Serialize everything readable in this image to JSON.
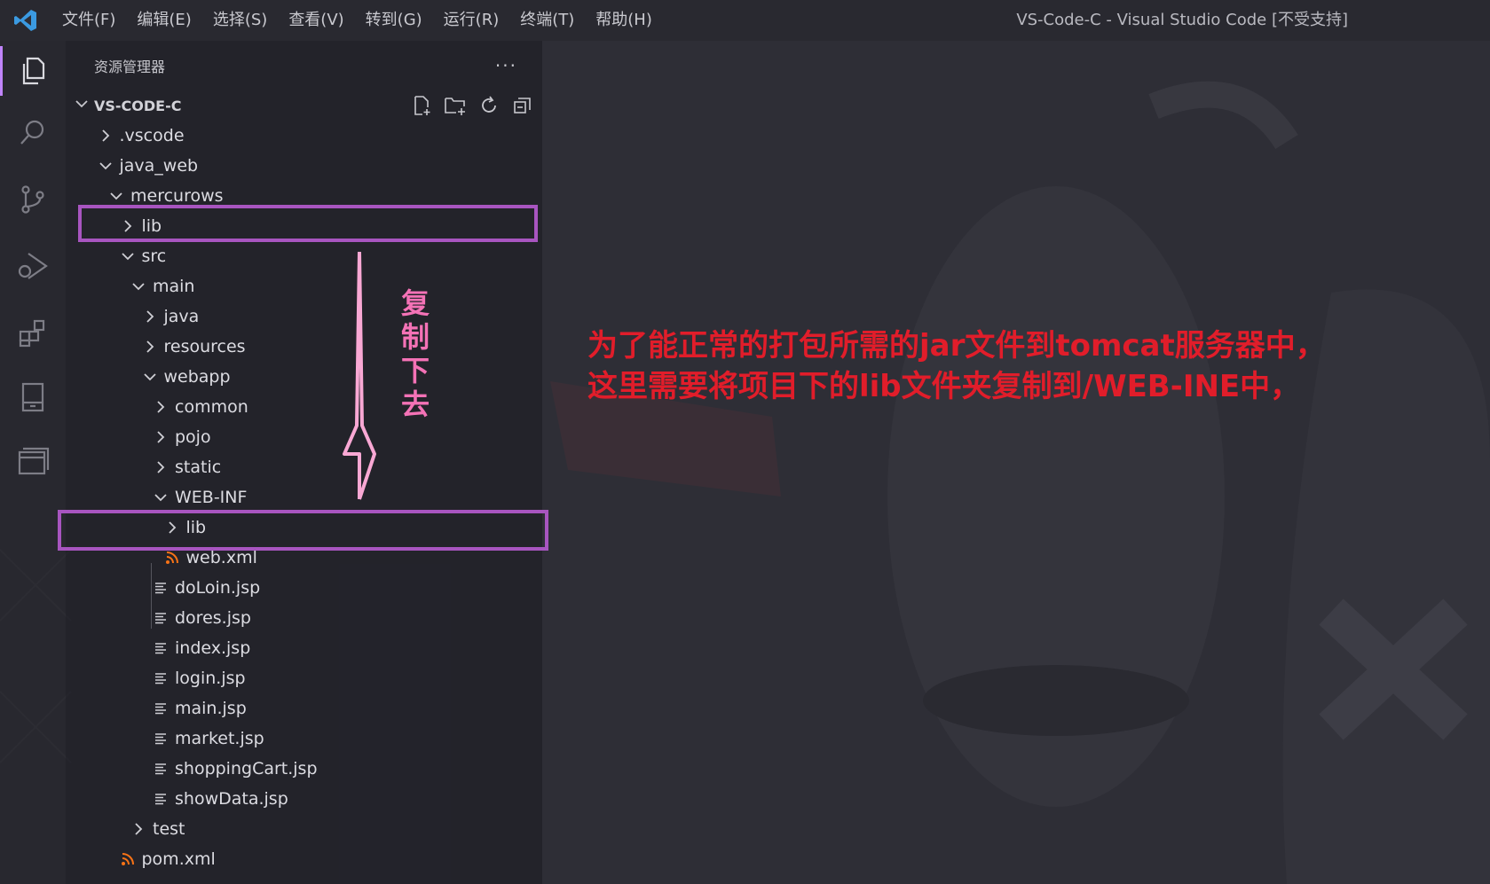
{
  "titlebar": {
    "menu": [
      "文件(F)",
      "编辑(E)",
      "选择(S)",
      "查看(V)",
      "转到(G)",
      "运行(R)",
      "终端(T)",
      "帮助(H)"
    ],
    "window_title": "VS-Code-C - Visual Studio Code [不受支持]"
  },
  "activitybar": {
    "items": [
      "explorer-icon",
      "search-icon",
      "source-control-icon",
      "run-debug-icon",
      "extensions-icon",
      "remote-explorer-icon",
      "panel-icon"
    ]
  },
  "sidebar": {
    "title": "资源管理器",
    "more": "···",
    "section": "VS-CODE-C",
    "tree": [
      {
        "label": ".vscode",
        "type": "folder",
        "expanded": false,
        "depth": 1
      },
      {
        "label": "java_web",
        "type": "folder",
        "expanded": true,
        "depth": 1
      },
      {
        "label": "mercurows",
        "type": "folder",
        "expanded": true,
        "depth": 2
      },
      {
        "label": "lib",
        "type": "folder",
        "expanded": false,
        "depth": 3
      },
      {
        "label": "src",
        "type": "folder",
        "expanded": true,
        "depth": 3
      },
      {
        "label": "main",
        "type": "folder",
        "expanded": true,
        "depth": 4
      },
      {
        "label": "java",
        "type": "folder",
        "expanded": false,
        "depth": 5
      },
      {
        "label": "resources",
        "type": "folder",
        "expanded": false,
        "depth": 5
      },
      {
        "label": "webapp",
        "type": "folder",
        "expanded": true,
        "depth": 5
      },
      {
        "label": "common",
        "type": "folder",
        "expanded": false,
        "depth": 6
      },
      {
        "label": "pojo",
        "type": "folder",
        "expanded": false,
        "depth": 6
      },
      {
        "label": "static",
        "type": "folder",
        "expanded": false,
        "depth": 6
      },
      {
        "label": "WEB-INF",
        "type": "folder",
        "expanded": true,
        "depth": 6
      },
      {
        "label": "lib",
        "type": "folder",
        "expanded": false,
        "depth": 7
      },
      {
        "label": "web.xml",
        "type": "xml",
        "depth": 7
      },
      {
        "label": "doLoin.jsp",
        "type": "file",
        "depth": 6
      },
      {
        "label": "dores.jsp",
        "type": "file",
        "depth": 6
      },
      {
        "label": "index.jsp",
        "type": "file",
        "depth": 6
      },
      {
        "label": "login.jsp",
        "type": "file",
        "depth": 6
      },
      {
        "label": "main.jsp",
        "type": "file",
        "depth": 6
      },
      {
        "label": "market.jsp",
        "type": "file",
        "depth": 6
      },
      {
        "label": "shoppingCart.jsp",
        "type": "file",
        "depth": 6
      },
      {
        "label": "showData.jsp",
        "type": "file",
        "depth": 6
      },
      {
        "label": "test",
        "type": "folder",
        "expanded": false,
        "depth": 4
      },
      {
        "label": "pom.xml",
        "type": "xml",
        "depth": 3
      }
    ]
  },
  "annotations": {
    "vertical_note": "复制下去",
    "line1": "为了能正常的打包所需的jar文件到tomcat服务器中，",
    "line2": "这里需要将项目下的lib文件夹复制到/WEB-INE中，"
  },
  "colors": {
    "highlight_box": "#a855c0",
    "arrow": "#f9a8d4",
    "note_red": "#e11d2a",
    "note_pink": "#f472b6",
    "accent": "#c084fc"
  }
}
